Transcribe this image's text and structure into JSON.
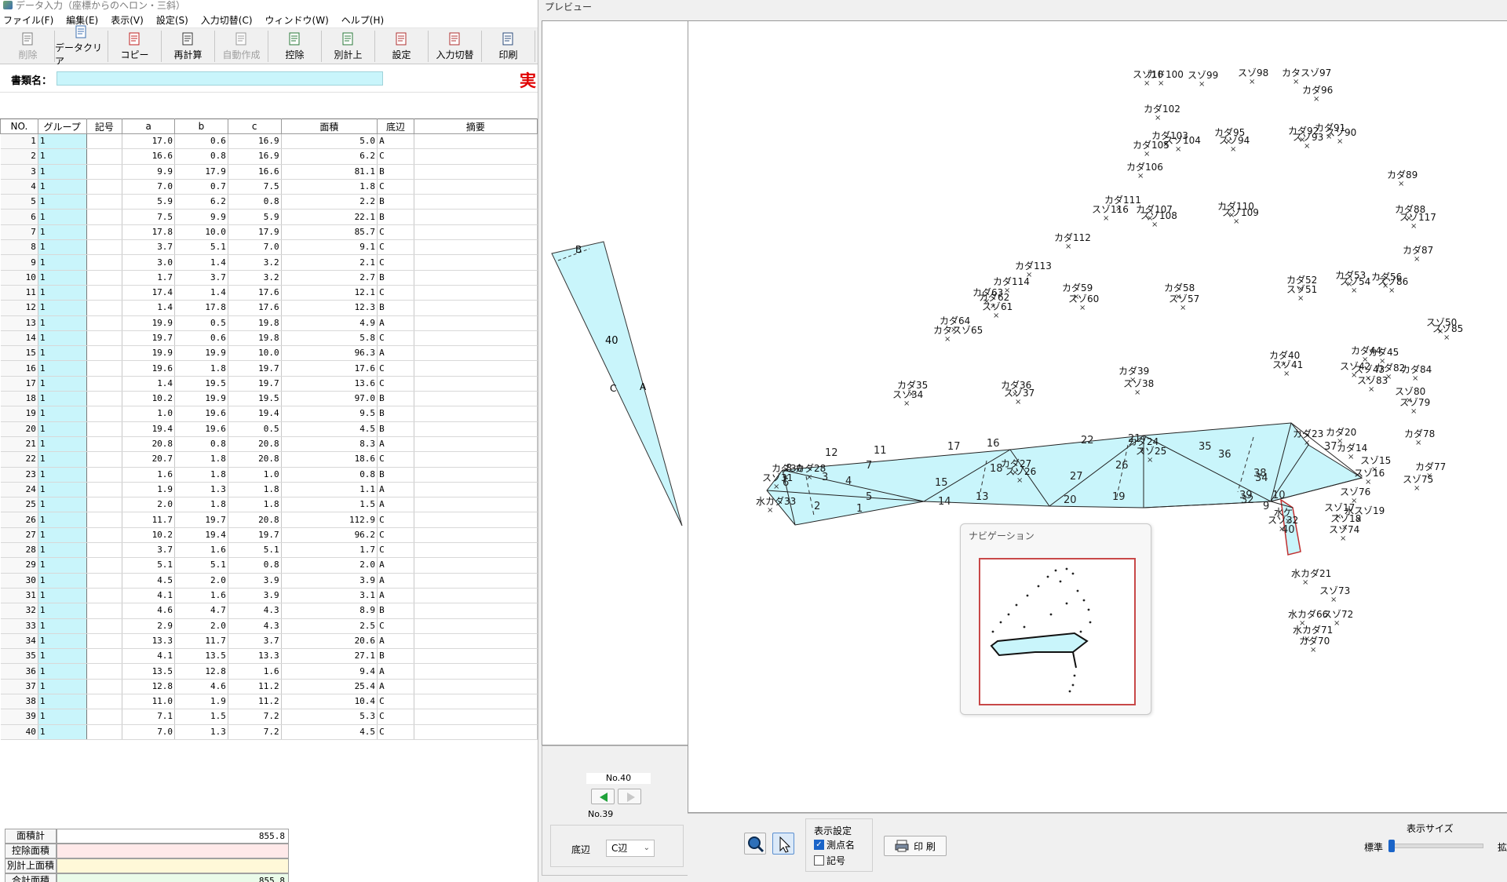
{
  "window": {
    "title": "データ入力（座標からのヘロン・三斜）",
    "preview_title": "プレビュー"
  },
  "menu": [
    "ファイル(F)",
    "編集(E)",
    "表示(V)",
    "設定(S)",
    "入力切替(C)",
    "ウィンドウ(W)",
    "ヘルプ(H)"
  ],
  "toolbar": [
    {
      "label": "削除",
      "icon": "delete-rows-icon",
      "enabled": false
    },
    {
      "label": "データクリア",
      "icon": "data-clear-icon",
      "enabled": true
    },
    {
      "label": "コピー",
      "icon": "copy-icon",
      "enabled": true
    },
    {
      "label": "再計算",
      "icon": "calculator-icon",
      "enabled": true
    },
    {
      "label": "自動作成",
      "icon": "auto-create-icon",
      "enabled": false
    },
    {
      "label": "控除",
      "icon": "deduct-icon",
      "enabled": true
    },
    {
      "label": "別計上",
      "icon": "separate-entry-icon",
      "enabled": true
    },
    {
      "label": "設定",
      "icon": "settings-icon",
      "enabled": true
    },
    {
      "label": "入力切替",
      "icon": "input-switch-icon",
      "enabled": true
    },
    {
      "label": "印刷",
      "icon": "print-icon",
      "enabled": true
    }
  ],
  "docname": {
    "label": "書類名：",
    "value": "",
    "exec_mark": "実"
  },
  "table": {
    "columns": [
      "NO.",
      "グループ",
      "記号",
      "a",
      "b",
      "c",
      "面積",
      "底辺",
      "摘要"
    ],
    "rows": [
      [
        "1",
        "1",
        "",
        "17.0",
        "0.6",
        "16.9",
        "5.0",
        "A",
        ""
      ],
      [
        "2",
        "1",
        "",
        "16.6",
        "0.8",
        "16.9",
        "6.2",
        "C",
        ""
      ],
      [
        "3",
        "1",
        "",
        "9.9",
        "17.9",
        "16.6",
        "81.1",
        "B",
        ""
      ],
      [
        "4",
        "1",
        "",
        "7.0",
        "0.7",
        "7.5",
        "1.8",
        "C",
        ""
      ],
      [
        "5",
        "1",
        "",
        "5.9",
        "6.2",
        "0.8",
        "2.2",
        "B",
        ""
      ],
      [
        "6",
        "1",
        "",
        "7.5",
        "9.9",
        "5.9",
        "22.1",
        "B",
        ""
      ],
      [
        "7",
        "1",
        "",
        "17.8",
        "10.0",
        "17.9",
        "85.7",
        "C",
        ""
      ],
      [
        "8",
        "1",
        "",
        "3.7",
        "5.1",
        "7.0",
        "9.1",
        "C",
        ""
      ],
      [
        "9",
        "1",
        "",
        "3.0",
        "1.4",
        "3.2",
        "2.1",
        "C",
        ""
      ],
      [
        "10",
        "1",
        "",
        "1.7",
        "3.7",
        "3.2",
        "2.7",
        "B",
        ""
      ],
      [
        "11",
        "1",
        "",
        "17.4",
        "1.4",
        "17.6",
        "12.1",
        "C",
        ""
      ],
      [
        "12",
        "1",
        "",
        "1.4",
        "17.8",
        "17.6",
        "12.3",
        "B",
        ""
      ],
      [
        "13",
        "1",
        "",
        "19.9",
        "0.5",
        "19.8",
        "4.9",
        "A",
        ""
      ],
      [
        "14",
        "1",
        "",
        "19.7",
        "0.6",
        "19.8",
        "5.8",
        "C",
        ""
      ],
      [
        "15",
        "1",
        "",
        "19.9",
        "19.9",
        "10.0",
        "96.3",
        "A",
        ""
      ],
      [
        "16",
        "1",
        "",
        "19.6",
        "1.8",
        "19.7",
        "17.6",
        "C",
        ""
      ],
      [
        "17",
        "1",
        "",
        "1.4",
        "19.5",
        "19.7",
        "13.6",
        "C",
        ""
      ],
      [
        "18",
        "1",
        "",
        "10.2",
        "19.9",
        "19.5",
        "97.0",
        "B",
        ""
      ],
      [
        "19",
        "1",
        "",
        "1.0",
        "19.6",
        "19.4",
        "9.5",
        "B",
        ""
      ],
      [
        "20",
        "1",
        "",
        "19.4",
        "19.6",
        "0.5",
        "4.5",
        "B",
        ""
      ],
      [
        "21",
        "1",
        "",
        "20.8",
        "0.8",
        "20.8",
        "8.3",
        "A",
        ""
      ],
      [
        "22",
        "1",
        "",
        "20.7",
        "1.8",
        "20.8",
        "18.6",
        "C",
        ""
      ],
      [
        "23",
        "1",
        "",
        "1.6",
        "1.8",
        "1.0",
        "0.8",
        "B",
        ""
      ],
      [
        "24",
        "1",
        "",
        "1.9",
        "1.3",
        "1.8",
        "1.1",
        "A",
        ""
      ],
      [
        "25",
        "1",
        "",
        "2.0",
        "1.8",
        "1.8",
        "1.5",
        "A",
        ""
      ],
      [
        "26",
        "1",
        "",
        "11.7",
        "19.7",
        "20.8",
        "112.9",
        "C",
        ""
      ],
      [
        "27",
        "1",
        "",
        "10.2",
        "19.4",
        "19.7",
        "96.2",
        "C",
        ""
      ],
      [
        "28",
        "1",
        "",
        "3.7",
        "1.6",
        "5.1",
        "1.7",
        "C",
        ""
      ],
      [
        "29",
        "1",
        "",
        "5.1",
        "5.1",
        "0.8",
        "2.0",
        "A",
        ""
      ],
      [
        "30",
        "1",
        "",
        "4.5",
        "2.0",
        "3.9",
        "3.9",
        "A",
        ""
      ],
      [
        "31",
        "1",
        "",
        "4.1",
        "1.6",
        "3.9",
        "3.1",
        "A",
        ""
      ],
      [
        "32",
        "1",
        "",
        "4.6",
        "4.7",
        "4.3",
        "8.9",
        "B",
        ""
      ],
      [
        "33",
        "1",
        "",
        "2.9",
        "2.0",
        "4.3",
        "2.5",
        "C",
        ""
      ],
      [
        "34",
        "1",
        "",
        "13.3",
        "11.7",
        "3.7",
        "20.6",
        "A",
        ""
      ],
      [
        "35",
        "1",
        "",
        "4.1",
        "13.5",
        "13.3",
        "27.1",
        "B",
        ""
      ],
      [
        "36",
        "1",
        "",
        "13.5",
        "12.8",
        "1.6",
        "9.4",
        "A",
        ""
      ],
      [
        "37",
        "1",
        "",
        "12.8",
        "4.6",
        "11.2",
        "25.4",
        "A",
        ""
      ],
      [
        "38",
        "1",
        "",
        "11.0",
        "1.9",
        "11.2",
        "10.4",
        "C",
        ""
      ],
      [
        "39",
        "1",
        "",
        "7.1",
        "1.5",
        "7.2",
        "5.3",
        "C",
        ""
      ],
      [
        "40",
        "1",
        "",
        "7.0",
        "1.3",
        "7.2",
        "4.5",
        "C",
        ""
      ]
    ]
  },
  "totals": [
    {
      "label": "面積計",
      "value": "855.8"
    },
    {
      "label": "控除面積",
      "value": ""
    },
    {
      "label": "別計上面積",
      "value": ""
    },
    {
      "label": "合計面積",
      "value": "855.8"
    }
  ],
  "preview": {
    "current_no": "No.40",
    "prev_no": "No.39",
    "base_label": "底辺",
    "base_value": "C辺",
    "single_triangle": {
      "top_label": "B",
      "center_label": "40",
      "side_left": "C",
      "side_right": "A"
    },
    "display_settings_title": "表示設定",
    "chk_point_name": "測点名",
    "chk_point_name_checked": true,
    "chk_symbol": "記号",
    "chk_symbol_checked": false,
    "print_label": "印 刷",
    "display_size_title": "表示サイズ",
    "size_min": "標準",
    "size_max": "拡"
  },
  "navigation": {
    "title": "ナビゲーション"
  },
  "triangle_labels": [
    "1",
    "2",
    "3",
    "4",
    "5",
    "6",
    "7",
    "8",
    "9",
    "10",
    "11",
    "12",
    "13",
    "14",
    "15",
    "16",
    "17",
    "18",
    "19",
    "20",
    "21",
    "22",
    "26",
    "27",
    "32",
    "34",
    "35",
    "36",
    "37",
    "38",
    "39",
    "40"
  ],
  "point_labels": [
    "スゾ10",
    "カド100",
    "スゾ99",
    "スゾ98",
    "カタスゾ97",
    "カダ96",
    "カダ102",
    "カダ103",
    "カダ105",
    "スゾ104",
    "カダ95",
    "スゾ94",
    "カダ92",
    "スゾ93",
    "カダ91",
    "スゾ90",
    "カダ106",
    "カダ89",
    "カダ111",
    "スゾ116",
    "カダ107",
    "スゾ108",
    "カダ110",
    "スゾ109",
    "カダ88",
    "スゾ117",
    "カダ112",
    "カダ87",
    "カダ113",
    "カダ114",
    "カダ59",
    "スゾ60",
    "カダ58",
    "スゾ57",
    "カダ52",
    "スゾ51",
    "カダ53",
    "スゾ54",
    "カダ56",
    "スゾ86",
    "カダ63",
    "カダ62",
    "スゾ61",
    "カダ64",
    "カタスゾ65",
    "スゾ50",
    "スゾ85",
    "カダ44",
    "カダ45",
    "カダ40",
    "スゾ41",
    "スゾ42",
    "スゾ43",
    "カダ82",
    "カダ84",
    "カダ39",
    "スゾ38",
    "カダ35",
    "スゾ34",
    "カダ36",
    "スゾ37",
    "スゾ83",
    "スゾ80",
    "スゾ79",
    "カダ78",
    "カダ23",
    "カダ20",
    "カダ24",
    "スゾ25",
    "カダ30",
    "カダ28",
    "スゾ31",
    "カダ27",
    "スゾ26",
    "カダ14",
    "スゾ15",
    "スゾ16",
    "カダ77",
    "スゾ75",
    "スゾ76",
    "スゾ17",
    "水スゾ19",
    "スゾ18",
    "スゾ74",
    "水カダ33",
    "水ケ",
    "スゾ32",
    "水カダ21",
    "スゾ73",
    "水カダ66",
    "スゾ72",
    "水カダ71",
    "カダ70"
  ]
}
